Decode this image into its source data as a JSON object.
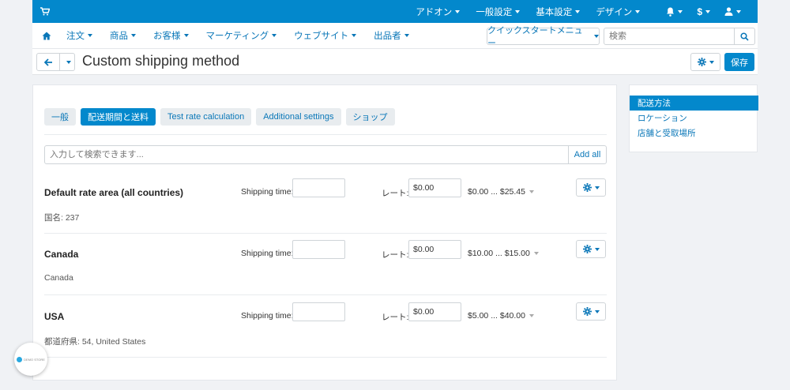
{
  "topbar": {
    "menus": [
      {
        "label": "アドオン"
      },
      {
        "label": "一般設定"
      },
      {
        "label": "基本設定"
      },
      {
        "label": "デザイン"
      }
    ],
    "currency": "$"
  },
  "nav": {
    "menus": [
      {
        "label": "注文"
      },
      {
        "label": "商品"
      },
      {
        "label": "お客様"
      },
      {
        "label": "マーケティング"
      },
      {
        "label": "ウェブサイト"
      },
      {
        "label": "出品者"
      }
    ],
    "quickstart_label": "クイックスタートメニュー",
    "search_placeholder": "検索"
  },
  "title": {
    "text": "Custom shipping method",
    "save_label": "保存"
  },
  "tabs": [
    {
      "label": "一般",
      "active": false
    },
    {
      "label": "配送期間と送料",
      "active": true
    },
    {
      "label": "Test rate calculation",
      "active": false
    },
    {
      "label": "Additional settings",
      "active": false
    },
    {
      "label": "ショップ",
      "active": false
    }
  ],
  "add_row": {
    "placeholder": "入力して検索できます...",
    "add_all_label": "Add all"
  },
  "shipping_time_label": "Shipping time:",
  "rate_label": "レート:",
  "areas": [
    {
      "name": "Default rate area (all countries)",
      "subtitle": "国名: 237",
      "rate": "$0.00",
      "range": "$0.00 ... $25.45"
    },
    {
      "name": "Canada",
      "subtitle": "Canada",
      "rate": "$0.00",
      "range": "$10.00 ... $15.00"
    },
    {
      "name": "USA",
      "subtitle": "都道府県: 54, United States",
      "rate": "$0.00",
      "range": "$5.00 ... $40.00"
    }
  ],
  "sidebar": {
    "items": [
      {
        "label": "配送方法",
        "active": true
      },
      {
        "label": "ロケーション",
        "active": false
      },
      {
        "label": "店舗と受取場所",
        "active": false
      }
    ]
  },
  "badge": {
    "text": "DEMO STORE"
  },
  "colors": {
    "primary": "#0388cc",
    "link": "#0a77b8",
    "background": "#f0f2f5"
  }
}
